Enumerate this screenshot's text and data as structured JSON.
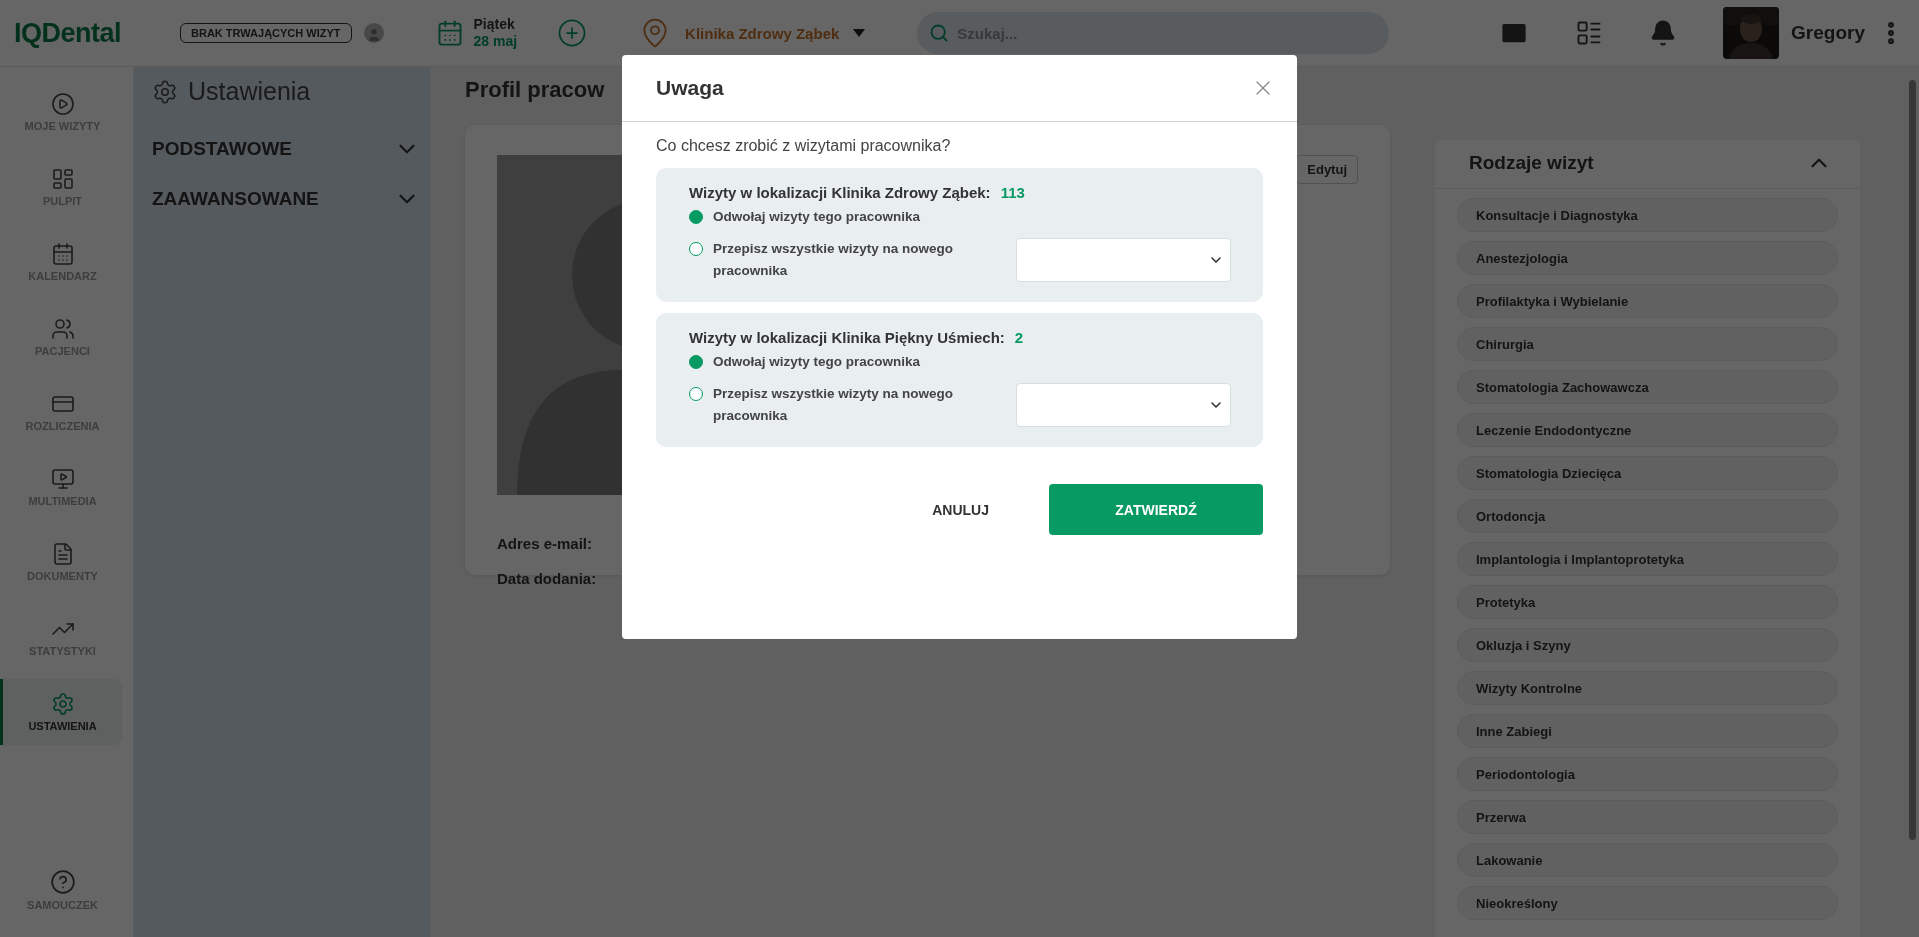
{
  "header": {
    "logo": "IQDental",
    "status_badge": "BRAK TRWAJĄCYCH WIZYT",
    "date": {
      "weekday": "Piątek",
      "day": "28 maj"
    },
    "clinic": "Klinika Zdrowy Ząbek",
    "search": {
      "placeholder": "Szukaj..."
    },
    "user": {
      "name": "Gregory"
    }
  },
  "nav": {
    "items": [
      {
        "label": "MOJE WIZYTY",
        "selected": false
      },
      {
        "label": "PULPIT",
        "selected": false
      },
      {
        "label": "KALENDARZ",
        "selected": false
      },
      {
        "label": "PACJENCI",
        "selected": false
      },
      {
        "label": "ROZLICZENIA",
        "selected": false
      },
      {
        "label": "MULTIMEDIA",
        "selected": false
      },
      {
        "label": "DOKUMENTY",
        "selected": false
      },
      {
        "label": "STATYSTYKI",
        "selected": false
      },
      {
        "label": "USTAWIENIA",
        "selected": true
      }
    ],
    "help": {
      "label": "SAMOUCZEK"
    }
  },
  "settings": {
    "title": "Ustawienia",
    "sections": [
      {
        "label": "PODSTAWOWE",
        "expanded": false
      },
      {
        "label": "ZAAWANSOWANE",
        "expanded": false
      }
    ]
  },
  "profile": {
    "title": "Profil pracow",
    "edit_button": "Edytuj",
    "fields": [
      "Adres e-mail:",
      "Data dodania:"
    ]
  },
  "visit_types": {
    "title": "Rodzaje wizyt",
    "expanded": true,
    "items": [
      "Konsultacje i Diagnostyka",
      "Anestezjologia",
      "Profilaktyka i Wybielanie",
      "Chirurgia",
      "Stomatologia Zachowawcza",
      "Leczenie Endodontyczne",
      "Stomatologia Dziecięca",
      "Ortodoncja",
      "Implantologia i Implantoprotetyka",
      "Protetyka",
      "Okluzja i Szyny",
      "Wizyty Kontrolne",
      "Inne Zabiegi",
      "Periodontologia",
      "Przerwa",
      "Lakowanie",
      "Nieokreślony"
    ]
  },
  "dialog": {
    "title": "Uwaga",
    "question": "Co chcesz zrobić z wizytami pracownika?",
    "locations": [
      {
        "heading": "Wizyty w lokalizacji Klinika Zdrowy Ząbek:",
        "count": "113",
        "options": [
          {
            "label": "Odwołaj wizyty tego pracownika",
            "selected": true,
            "kind": "plain"
          },
          {
            "label": "Przepisz wszystkie wizyty na nowego pracownika",
            "selected": false,
            "kind": "with_select"
          }
        ]
      },
      {
        "heading": "Wizyty w lokalizacji Klinika Piękny Uśmiech:",
        "count": "2",
        "options": [
          {
            "label": "Odwołaj wizyty tego pracownika",
            "selected": true,
            "kind": "plain"
          },
          {
            "label": "Przepisz wszystkie wizyty na nowego pracownika",
            "selected": false,
            "kind": "with_select"
          }
        ]
      }
    ],
    "buttons": [
      {
        "label": "ANULUJ",
        "kind": "text"
      },
      {
        "label": "ZATWIERDŹ",
        "kind": "primary"
      }
    ]
  }
}
